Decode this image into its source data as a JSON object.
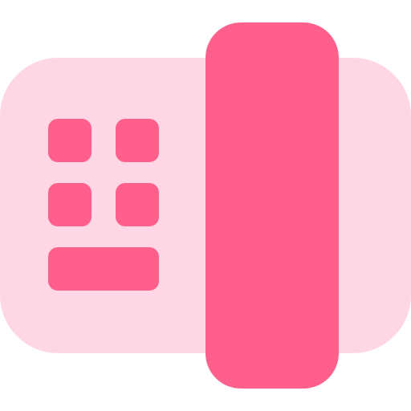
{
  "icon": {
    "name": "fax-machine-icon",
    "colors": {
      "body": "#FFD6E6",
      "accent": "#FF5F8B",
      "background": "#FFFFFF"
    }
  }
}
